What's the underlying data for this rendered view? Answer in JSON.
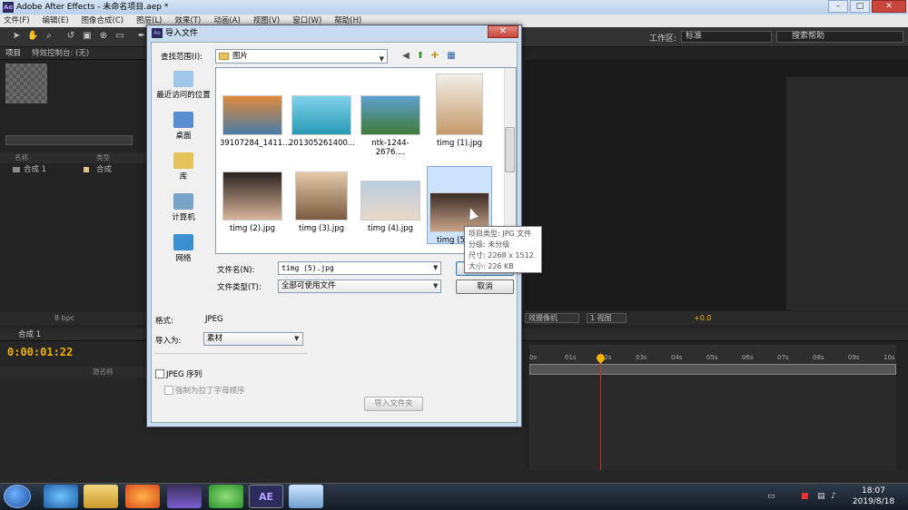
{
  "window": {
    "title": "Adobe After Effects - 未命名项目.aep *",
    "app_icon": "Ae"
  },
  "menu": [
    "文件(F)",
    "编辑(E)",
    "图像合成(C)",
    "图层(L)",
    "效果(T)",
    "动画(A)",
    "视图(V)",
    "窗口(W)",
    "帮助(H)"
  ],
  "toolbar": {
    "workspace_label": "工作区:",
    "workspace_value": "标准",
    "help_search": "搜索帮助"
  },
  "project_panel": {
    "tab_project": "项目",
    "tab_effects": "特效控制台: (无)",
    "col_name": "名称",
    "col_type": "类型",
    "item_name": "合成 1",
    "item_type": "合成",
    "bpc": "8 bpc"
  },
  "viewer": {
    "camera": "效摄像机",
    "views": "1 视图",
    "exposure": "+0.0"
  },
  "timeline": {
    "tab": "合成 1",
    "timecode": "0:00:01:22",
    "col_source": "源名称",
    "ticks": [
      "0s",
      "01s",
      "02s",
      "03s",
      "04s",
      "05s",
      "06s",
      "07s",
      "08s",
      "09s",
      "10s"
    ]
  },
  "taskbar": {
    "time": "18:07",
    "date": "2019/8/18",
    "ae_label": "AE"
  },
  "dialog": {
    "title": "导入文件",
    "look_in_label": "查找范围(I):",
    "look_in_value": "图片",
    "places": [
      "最近访问的位置",
      "桌面",
      "库",
      "计算机",
      "网络"
    ],
    "files": [
      {
        "name": "39107284_1411...",
        "colors": [
          "#e08a3a",
          "#4a7da8"
        ]
      },
      {
        "name": "201305261400...",
        "colors": [
          "#7fd3ea",
          "#2a9ab5"
        ]
      },
      {
        "name": "ntk-1244-2676....",
        "colors": [
          "#5fa0cf",
          "#3f7b3a"
        ]
      },
      {
        "name": "timg (1).jpg",
        "colors": [
          "#f2efe8",
          "#c49a6a"
        ]
      },
      {
        "name": "timg (2).jpg",
        "colors": [
          "#2a2320",
          "#d8b49a"
        ]
      },
      {
        "name": "timg (3).jpg",
        "colors": [
          "#e4c9a6",
          "#7a5a40"
        ]
      },
      {
        "name": "timg (4).jpg",
        "colors": [
          "#b8cde0",
          "#e9d8c8"
        ]
      },
      {
        "name": "timg (5).jpg",
        "colors": [
          "#3a2c26",
          "#c9a48c"
        ]
      }
    ],
    "filename_label": "文件名(N):",
    "filename_value": "timg (5).jpg",
    "filetype_label": "文件类型(T):",
    "filetype_value": "全部可使用文件",
    "open_button": "打开",
    "cancel_button": "取消",
    "format_label": "格式:",
    "format_value": "JPEG",
    "import_as_label": "导入为:",
    "import_as_value": "素材",
    "jpeg_sequence": "JPEG 序列",
    "force_alpha": "强制为拉丁字母顺序",
    "import_folder_button": "导入文件夹"
  },
  "tooltip": {
    "type": "项目类型: JPG 文件",
    "rating": "分级: 未分级",
    "size_dims": "尺寸: 2268 x 1512",
    "file_size": "大小: 226 KB"
  }
}
